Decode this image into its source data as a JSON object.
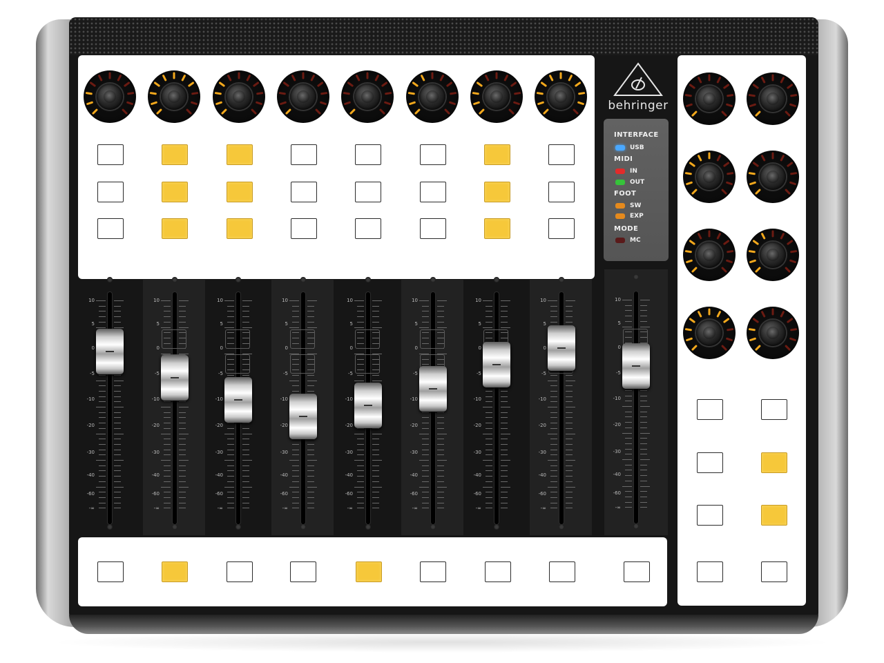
{
  "brand": {
    "name": "behringer"
  },
  "status_panel": {
    "groups": [
      {
        "title": "INTERFACE",
        "items": [
          {
            "label": "USB",
            "led": "#4aa8ff"
          }
        ]
      },
      {
        "title": "MIDI",
        "items": [
          {
            "label": "IN",
            "led": "#e22b2b"
          },
          {
            "label": "OUT",
            "led": "#36c33a"
          }
        ]
      },
      {
        "title": "FOOT",
        "items": [
          {
            "label": "SW",
            "led": "#e58a1d"
          },
          {
            "label": "EXP",
            "led": "#e58a1d"
          }
        ]
      },
      {
        "title": "MODE",
        "items": [
          {
            "label": "MC",
            "led": "#5a1a1a"
          }
        ]
      }
    ]
  },
  "colors": {
    "led_on": "#f3a81c",
    "led_off": "#6b1b12",
    "button_lit": "#f6c83a"
  },
  "fader_scale": [
    "10",
    "5",
    "0",
    "-5",
    "-10",
    "-20",
    "-30",
    "-40",
    "-60",
    "-∞"
  ],
  "top_encoders": [
    {
      "id": 1,
      "lit_segments": 3
    },
    {
      "id": 2,
      "lit_segments": 8
    },
    {
      "id": 3,
      "lit_segments": 4
    },
    {
      "id": 4,
      "lit_segments": 1
    },
    {
      "id": 5,
      "lit_segments": 1
    },
    {
      "id": 6,
      "lit_segments": 5
    },
    {
      "id": 7,
      "lit_segments": 4
    },
    {
      "id": 8,
      "lit_segments": 10
    }
  ],
  "top_buttons": [
    [
      false,
      true,
      true,
      false,
      false,
      false,
      true,
      false
    ],
    [
      false,
      true,
      true,
      false,
      false,
      false,
      true,
      false
    ],
    [
      false,
      true,
      true,
      false,
      false,
      false,
      true,
      false
    ]
  ],
  "faders": [
    {
      "id": 1,
      "level": 0.73
    },
    {
      "id": 2,
      "level": 0.59
    },
    {
      "id": 3,
      "level": 0.47
    },
    {
      "id": 4,
      "level": 0.38
    },
    {
      "id": 5,
      "level": 0.44
    },
    {
      "id": 6,
      "level": 0.53
    },
    {
      "id": 7,
      "level": 0.66
    },
    {
      "id": 8,
      "level": 0.75
    },
    {
      "id": 9,
      "level": 0.65
    }
  ],
  "bottom_buttons": [
    false,
    true,
    false,
    false,
    true,
    false,
    false,
    false,
    false
  ],
  "right_encoders": [
    {
      "id": 1,
      "lit_segments": 1
    },
    {
      "id": 2,
      "lit_segments": 1
    },
    {
      "id": 3,
      "lit_segments": 6
    },
    {
      "id": 4,
      "lit_segments": 3
    },
    {
      "id": 5,
      "lit_segments": 4
    },
    {
      "id": 6,
      "lit_segments": 5
    },
    {
      "id": 7,
      "lit_segments": 8
    },
    {
      "id": 8,
      "lit_segments": 3
    }
  ],
  "right_buttons": [
    [
      false,
      false
    ],
    [
      false,
      true
    ],
    [
      false,
      true
    ],
    [
      false,
      false
    ]
  ]
}
